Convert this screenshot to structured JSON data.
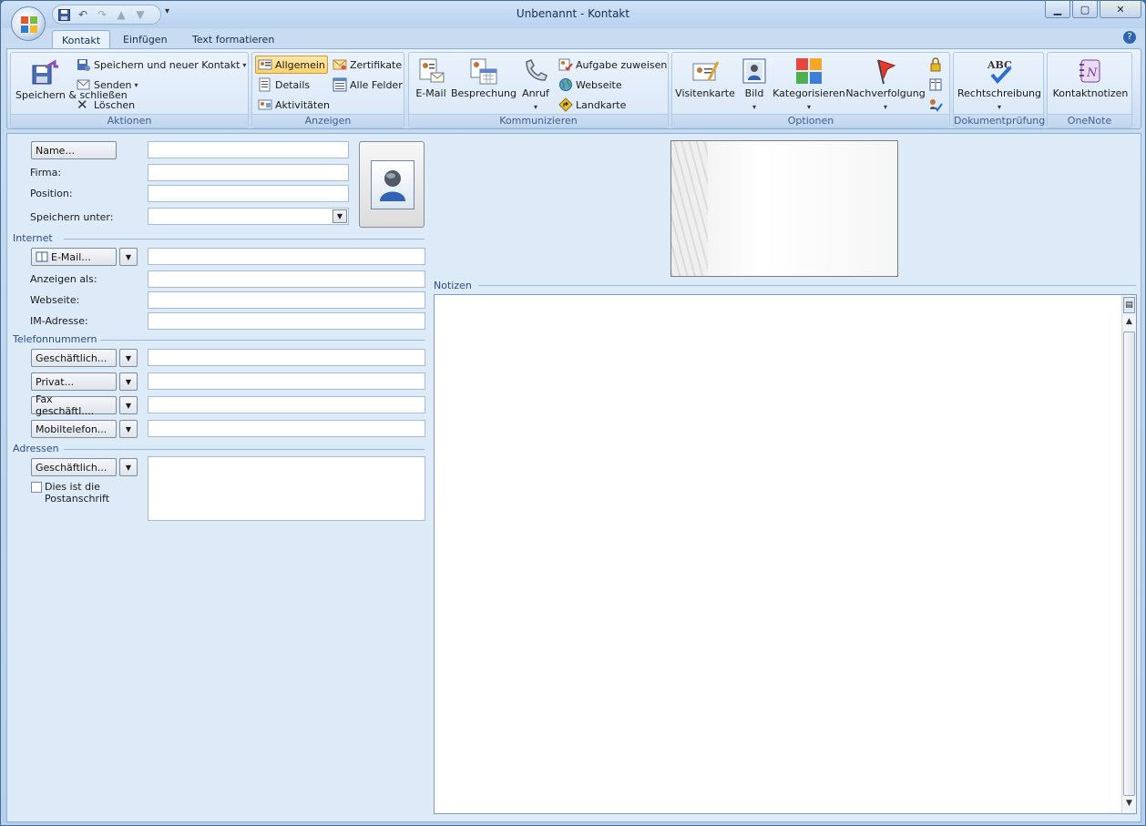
{
  "window": {
    "title": "Unbenannt - Kontakt"
  },
  "tabs": [
    {
      "label": "Kontakt",
      "active": true
    },
    {
      "label": "Einfügen",
      "active": false
    },
    {
      "label": "Text formatieren",
      "active": false
    }
  ],
  "ribbon": {
    "aktionen": {
      "label": "Aktionen",
      "save_close": "Speichern & schließen",
      "save_new": "Speichern und neuer Kontakt",
      "send": "Senden",
      "delete": "Löschen"
    },
    "anzeigen": {
      "label": "Anzeigen",
      "allgemein": "Allgemein",
      "details": "Details",
      "aktivitaeten": "Aktivitäten",
      "zertifikate": "Zertifikate",
      "alle_felder": "Alle Felder"
    },
    "kommunizieren": {
      "label": "Kommunizieren",
      "email": "E-Mail",
      "besprechung": "Besprechung",
      "anruf": "Anruf",
      "aufgabe": "Aufgabe zuweisen",
      "webseite": "Webseite",
      "landkarte": "Landkarte"
    },
    "optionen": {
      "label": "Optionen",
      "visitenkarte": "Visitenkarte",
      "bild": "Bild",
      "kategorisieren": "Kategorisieren",
      "nachverfolgung": "Nachverfolgung"
    },
    "dokumentpruefung": {
      "label": "Dokumentprüfung",
      "rechtschreibung": "Rechtschreibung"
    },
    "onenote": {
      "label": "OneNote",
      "kontaktnotizen": "Kontaktnotizen"
    }
  },
  "form": {
    "name_button": "Name...",
    "firma": "Firma:",
    "position": "Position:",
    "speichern_unter": "Speichern unter:",
    "internet_header": "Internet",
    "email_button": "E-Mail...",
    "anzeigen_als": "Anzeigen als:",
    "webseite": "Webseite:",
    "im_adresse": "IM-Adresse:",
    "telefon_header": "Telefonnummern",
    "phone_buttons": [
      "Geschäftlich...",
      "Privat...",
      "Fax geschäftl....",
      "Mobiltelefon..."
    ],
    "adressen_header": "Adressen",
    "address_button": "Geschäftlich...",
    "postanschrift": "Dies ist die Postanschrift",
    "notizen_header": "Notizen"
  }
}
